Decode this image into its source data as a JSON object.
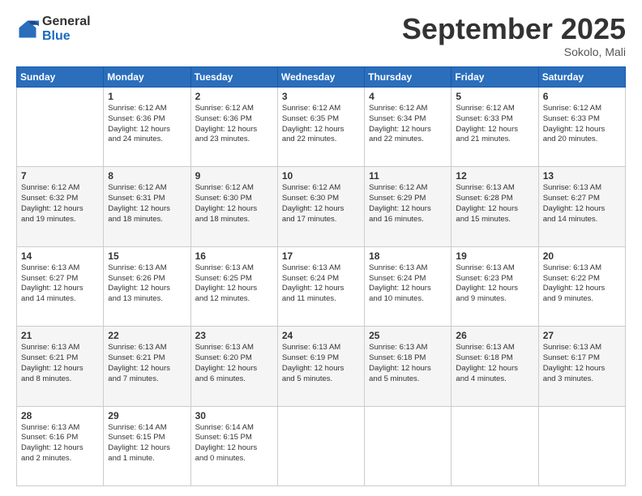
{
  "header": {
    "logo_line1": "General",
    "logo_line2": "Blue",
    "month": "September 2025",
    "location": "Sokolo, Mali"
  },
  "days_of_week": [
    "Sunday",
    "Monday",
    "Tuesday",
    "Wednesday",
    "Thursday",
    "Friday",
    "Saturday"
  ],
  "weeks": [
    [
      {
        "day": "",
        "info": ""
      },
      {
        "day": "1",
        "info": "Sunrise: 6:12 AM\nSunset: 6:36 PM\nDaylight: 12 hours\nand 24 minutes."
      },
      {
        "day": "2",
        "info": "Sunrise: 6:12 AM\nSunset: 6:36 PM\nDaylight: 12 hours\nand 23 minutes."
      },
      {
        "day": "3",
        "info": "Sunrise: 6:12 AM\nSunset: 6:35 PM\nDaylight: 12 hours\nand 22 minutes."
      },
      {
        "day": "4",
        "info": "Sunrise: 6:12 AM\nSunset: 6:34 PM\nDaylight: 12 hours\nand 22 minutes."
      },
      {
        "day": "5",
        "info": "Sunrise: 6:12 AM\nSunset: 6:33 PM\nDaylight: 12 hours\nand 21 minutes."
      },
      {
        "day": "6",
        "info": "Sunrise: 6:12 AM\nSunset: 6:33 PM\nDaylight: 12 hours\nand 20 minutes."
      }
    ],
    [
      {
        "day": "7",
        "info": "Sunrise: 6:12 AM\nSunset: 6:32 PM\nDaylight: 12 hours\nand 19 minutes."
      },
      {
        "day": "8",
        "info": "Sunrise: 6:12 AM\nSunset: 6:31 PM\nDaylight: 12 hours\nand 18 minutes."
      },
      {
        "day": "9",
        "info": "Sunrise: 6:12 AM\nSunset: 6:30 PM\nDaylight: 12 hours\nand 18 minutes."
      },
      {
        "day": "10",
        "info": "Sunrise: 6:12 AM\nSunset: 6:30 PM\nDaylight: 12 hours\nand 17 minutes."
      },
      {
        "day": "11",
        "info": "Sunrise: 6:12 AM\nSunset: 6:29 PM\nDaylight: 12 hours\nand 16 minutes."
      },
      {
        "day": "12",
        "info": "Sunrise: 6:13 AM\nSunset: 6:28 PM\nDaylight: 12 hours\nand 15 minutes."
      },
      {
        "day": "13",
        "info": "Sunrise: 6:13 AM\nSunset: 6:27 PM\nDaylight: 12 hours\nand 14 minutes."
      }
    ],
    [
      {
        "day": "14",
        "info": "Sunrise: 6:13 AM\nSunset: 6:27 PM\nDaylight: 12 hours\nand 14 minutes."
      },
      {
        "day": "15",
        "info": "Sunrise: 6:13 AM\nSunset: 6:26 PM\nDaylight: 12 hours\nand 13 minutes."
      },
      {
        "day": "16",
        "info": "Sunrise: 6:13 AM\nSunset: 6:25 PM\nDaylight: 12 hours\nand 12 minutes."
      },
      {
        "day": "17",
        "info": "Sunrise: 6:13 AM\nSunset: 6:24 PM\nDaylight: 12 hours\nand 11 minutes."
      },
      {
        "day": "18",
        "info": "Sunrise: 6:13 AM\nSunset: 6:24 PM\nDaylight: 12 hours\nand 10 minutes."
      },
      {
        "day": "19",
        "info": "Sunrise: 6:13 AM\nSunset: 6:23 PM\nDaylight: 12 hours\nand 9 minutes."
      },
      {
        "day": "20",
        "info": "Sunrise: 6:13 AM\nSunset: 6:22 PM\nDaylight: 12 hours\nand 9 minutes."
      }
    ],
    [
      {
        "day": "21",
        "info": "Sunrise: 6:13 AM\nSunset: 6:21 PM\nDaylight: 12 hours\nand 8 minutes."
      },
      {
        "day": "22",
        "info": "Sunrise: 6:13 AM\nSunset: 6:21 PM\nDaylight: 12 hours\nand 7 minutes."
      },
      {
        "day": "23",
        "info": "Sunrise: 6:13 AM\nSunset: 6:20 PM\nDaylight: 12 hours\nand 6 minutes."
      },
      {
        "day": "24",
        "info": "Sunrise: 6:13 AM\nSunset: 6:19 PM\nDaylight: 12 hours\nand 5 minutes."
      },
      {
        "day": "25",
        "info": "Sunrise: 6:13 AM\nSunset: 6:18 PM\nDaylight: 12 hours\nand 5 minutes."
      },
      {
        "day": "26",
        "info": "Sunrise: 6:13 AM\nSunset: 6:18 PM\nDaylight: 12 hours\nand 4 minutes."
      },
      {
        "day": "27",
        "info": "Sunrise: 6:13 AM\nSunset: 6:17 PM\nDaylight: 12 hours\nand 3 minutes."
      }
    ],
    [
      {
        "day": "28",
        "info": "Sunrise: 6:13 AM\nSunset: 6:16 PM\nDaylight: 12 hours\nand 2 minutes."
      },
      {
        "day": "29",
        "info": "Sunrise: 6:14 AM\nSunset: 6:15 PM\nDaylight: 12 hours\nand 1 minute."
      },
      {
        "day": "30",
        "info": "Sunrise: 6:14 AM\nSunset: 6:15 PM\nDaylight: 12 hours\nand 0 minutes."
      },
      {
        "day": "",
        "info": ""
      },
      {
        "day": "",
        "info": ""
      },
      {
        "day": "",
        "info": ""
      },
      {
        "day": "",
        "info": ""
      }
    ]
  ]
}
